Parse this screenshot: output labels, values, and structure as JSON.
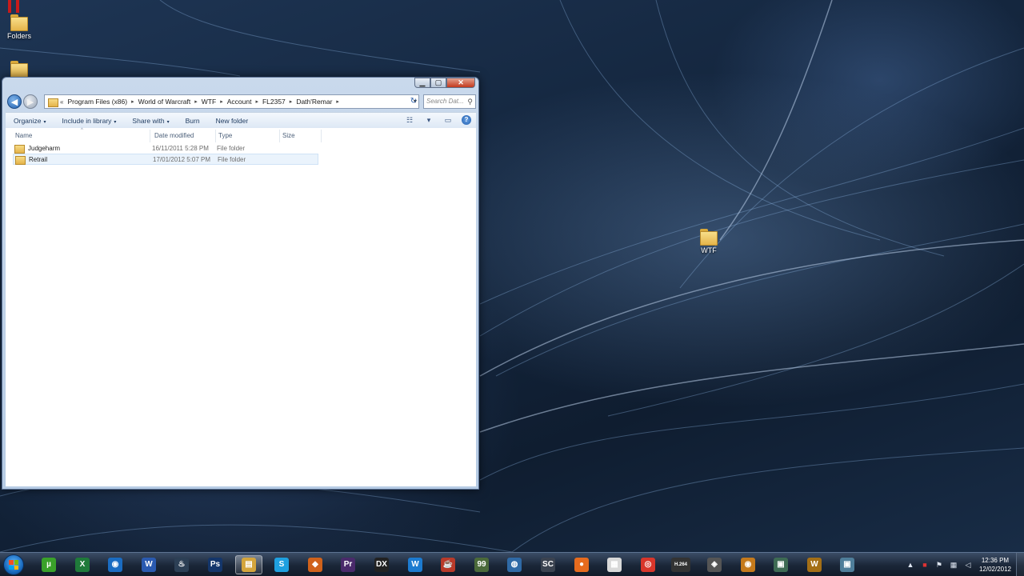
{
  "desktop": {
    "icons": [
      {
        "label": "Folders"
      },
      {
        "label": ""
      },
      {
        "label": "WTF"
      }
    ]
  },
  "explorer": {
    "controls": {
      "minimize": "▁",
      "maximize": "▢",
      "close": "✕"
    },
    "nav": {
      "back": "◀",
      "forward": "▶"
    },
    "address": {
      "chevron": "«",
      "crumbs": [
        "Program Files (x86)",
        "World of Warcraft",
        "WTF",
        "Account",
        "FL2357",
        "Dath'Remar"
      ],
      "separator": "▸",
      "dropdown": "▾"
    },
    "refresh": "↻",
    "search": {
      "placeholder": "Search Dat...",
      "icon": "⚲"
    },
    "toolbar": {
      "organize": "Organize",
      "include_in_library": "Include in library",
      "share_with": "Share with",
      "burn": "Burn",
      "new_folder": "New folder",
      "caret": "▾",
      "views": "☷",
      "views_caret": "▾",
      "preview_pane": "▭",
      "help": "?"
    },
    "columns": {
      "name": "Name",
      "date_modified": "Date modified",
      "type": "Type",
      "size": "Size",
      "sort_indicator": "^"
    },
    "rows": [
      {
        "name": "Judgeharm",
        "date": "16/11/2011 5:28 PM",
        "type": "File folder",
        "selected": false
      },
      {
        "name": "Retrail",
        "date": "17/01/2012 5:07 PM",
        "type": "File folder",
        "selected": true
      }
    ]
  },
  "taskbar": {
    "apps": [
      {
        "name": "utorrent",
        "glyph": "µ",
        "color": "#3aa12a"
      },
      {
        "name": "excel",
        "glyph": "X",
        "color": "#1f7a3a"
      },
      {
        "name": "media-center",
        "glyph": "◉",
        "color": "#1a6cc2"
      },
      {
        "name": "word",
        "glyph": "W",
        "color": "#2a5ab0"
      },
      {
        "name": "steam",
        "glyph": "♨",
        "color": "#2c3f55"
      },
      {
        "name": "photoshop",
        "glyph": "Ps",
        "color": "#14366b"
      },
      {
        "name": "explorer",
        "glyph": "▤",
        "color": "#d4a53c"
      },
      {
        "name": "skype",
        "glyph": "S",
        "color": "#1fa0e0"
      },
      {
        "name": "app-orange",
        "glyph": "◆",
        "color": "#d0621b"
      },
      {
        "name": "premiere",
        "glyph": "Pr",
        "color": "#4a2a6b"
      },
      {
        "name": "app-dx",
        "glyph": "DX",
        "color": "#222222"
      },
      {
        "name": "app-w-blue",
        "glyph": "W",
        "color": "#1c7bd0"
      },
      {
        "name": "java",
        "glyph": "☕",
        "color": "#b83a2a"
      },
      {
        "name": "app-99",
        "glyph": "99",
        "color": "#4b6a3a"
      },
      {
        "name": "app-globe",
        "glyph": "◍",
        "color": "#2f6aa6"
      },
      {
        "name": "app-sc",
        "glyph": "SC",
        "color": "#3b4350"
      },
      {
        "name": "app-origin",
        "glyph": "●",
        "color": "#e66b1e"
      },
      {
        "name": "app-doc",
        "glyph": "▦",
        "color": "#d9d9d9"
      },
      {
        "name": "chrome",
        "glyph": "◎",
        "color": "#d8362b"
      },
      {
        "name": "app-h264",
        "glyph": "H.264",
        "color": "#333333"
      },
      {
        "name": "app-diamond",
        "glyph": "◈",
        "color": "#555555"
      },
      {
        "name": "app-eye",
        "glyph": "◉",
        "color": "#c57a1c"
      },
      {
        "name": "app-window",
        "glyph": "▣",
        "color": "#3e6b54"
      },
      {
        "name": "wow",
        "glyph": "W",
        "color": "#a46f16"
      },
      {
        "name": "app-window2",
        "glyph": "▣",
        "color": "#4f7e9a"
      }
    ],
    "tray": {
      "expand": "▲",
      "icon1": "■",
      "flag": "⚑",
      "network": "▦",
      "volume": "◁",
      "time": "12:36 PM",
      "date": "12/02/2012"
    }
  }
}
